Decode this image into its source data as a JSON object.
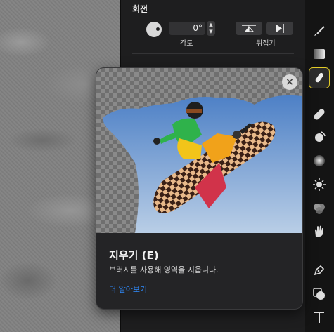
{
  "inspector": {
    "section_title": "회전",
    "angle_value": "0°",
    "angle_label": "각도",
    "flip_label": "뒤집기"
  },
  "popover": {
    "title": "지우기 (E)",
    "description": "브러시를 사용해 영역을 지웁니다.",
    "learn_more": "더 알아보기"
  },
  "toolbar": {
    "tools": [
      "paintbrush-icon",
      "gradient-icon",
      "eraser-icon",
      "bandage-icon",
      "blur-tool-icon",
      "sponge-icon",
      "light-icon",
      "color-icon",
      "smudge-icon",
      "pen-icon",
      "shape-icon",
      "text-icon"
    ],
    "selected": "eraser-icon",
    "accent_color": "#e3cc27"
  },
  "colors": {
    "link": "#2f8cff",
    "panel": "#1e1e1f",
    "popover": "#242426"
  }
}
